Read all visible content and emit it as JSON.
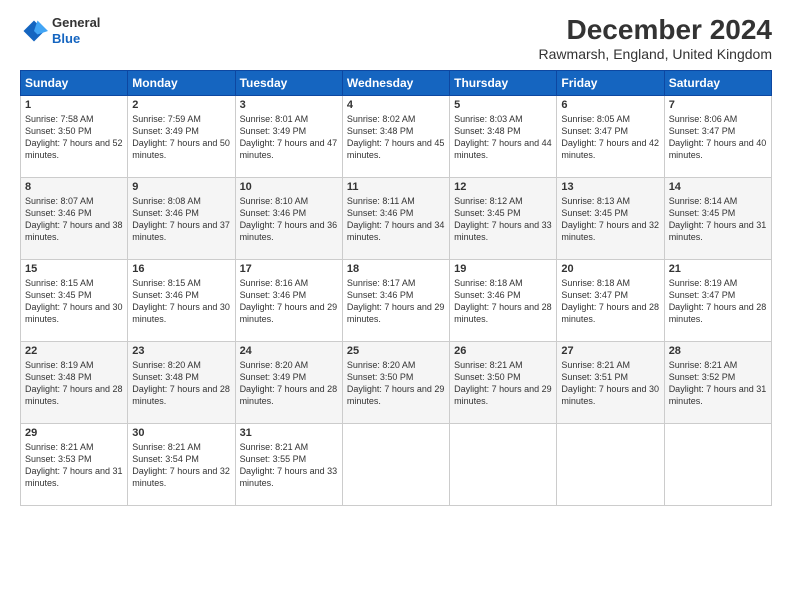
{
  "logo": {
    "line1": "General",
    "line2": "Blue"
  },
  "title": "December 2024",
  "subtitle": "Rawmarsh, England, United Kingdom",
  "header_days": [
    "Sunday",
    "Monday",
    "Tuesday",
    "Wednesday",
    "Thursday",
    "Friday",
    "Saturday"
  ],
  "weeks": [
    [
      {
        "day": "1",
        "sunrise": "7:58 AM",
        "sunset": "3:50 PM",
        "daylight": "7 hours and 52 minutes."
      },
      {
        "day": "2",
        "sunrise": "7:59 AM",
        "sunset": "3:49 PM",
        "daylight": "7 hours and 50 minutes."
      },
      {
        "day": "3",
        "sunrise": "8:01 AM",
        "sunset": "3:49 PM",
        "daylight": "7 hours and 47 minutes."
      },
      {
        "day": "4",
        "sunrise": "8:02 AM",
        "sunset": "3:48 PM",
        "daylight": "7 hours and 45 minutes."
      },
      {
        "day": "5",
        "sunrise": "8:03 AM",
        "sunset": "3:48 PM",
        "daylight": "7 hours and 44 minutes."
      },
      {
        "day": "6",
        "sunrise": "8:05 AM",
        "sunset": "3:47 PM",
        "daylight": "7 hours and 42 minutes."
      },
      {
        "day": "7",
        "sunrise": "8:06 AM",
        "sunset": "3:47 PM",
        "daylight": "7 hours and 40 minutes."
      }
    ],
    [
      {
        "day": "8",
        "sunrise": "8:07 AM",
        "sunset": "3:46 PM",
        "daylight": "7 hours and 38 minutes."
      },
      {
        "day": "9",
        "sunrise": "8:08 AM",
        "sunset": "3:46 PM",
        "daylight": "7 hours and 37 minutes."
      },
      {
        "day": "10",
        "sunrise": "8:10 AM",
        "sunset": "3:46 PM",
        "daylight": "7 hours and 36 minutes."
      },
      {
        "day": "11",
        "sunrise": "8:11 AM",
        "sunset": "3:46 PM",
        "daylight": "7 hours and 34 minutes."
      },
      {
        "day": "12",
        "sunrise": "8:12 AM",
        "sunset": "3:45 PM",
        "daylight": "7 hours and 33 minutes."
      },
      {
        "day": "13",
        "sunrise": "8:13 AM",
        "sunset": "3:45 PM",
        "daylight": "7 hours and 32 minutes."
      },
      {
        "day": "14",
        "sunrise": "8:14 AM",
        "sunset": "3:45 PM",
        "daylight": "7 hours and 31 minutes."
      }
    ],
    [
      {
        "day": "15",
        "sunrise": "8:15 AM",
        "sunset": "3:45 PM",
        "daylight": "7 hours and 30 minutes."
      },
      {
        "day": "16",
        "sunrise": "8:15 AM",
        "sunset": "3:46 PM",
        "daylight": "7 hours and 30 minutes."
      },
      {
        "day": "17",
        "sunrise": "8:16 AM",
        "sunset": "3:46 PM",
        "daylight": "7 hours and 29 minutes."
      },
      {
        "day": "18",
        "sunrise": "8:17 AM",
        "sunset": "3:46 PM",
        "daylight": "7 hours and 29 minutes."
      },
      {
        "day": "19",
        "sunrise": "8:18 AM",
        "sunset": "3:46 PM",
        "daylight": "7 hours and 28 minutes."
      },
      {
        "day": "20",
        "sunrise": "8:18 AM",
        "sunset": "3:47 PM",
        "daylight": "7 hours and 28 minutes."
      },
      {
        "day": "21",
        "sunrise": "8:19 AM",
        "sunset": "3:47 PM",
        "daylight": "7 hours and 28 minutes."
      }
    ],
    [
      {
        "day": "22",
        "sunrise": "8:19 AM",
        "sunset": "3:48 PM",
        "daylight": "7 hours and 28 minutes."
      },
      {
        "day": "23",
        "sunrise": "8:20 AM",
        "sunset": "3:48 PM",
        "daylight": "7 hours and 28 minutes."
      },
      {
        "day": "24",
        "sunrise": "8:20 AM",
        "sunset": "3:49 PM",
        "daylight": "7 hours and 28 minutes."
      },
      {
        "day": "25",
        "sunrise": "8:20 AM",
        "sunset": "3:50 PM",
        "daylight": "7 hours and 29 minutes."
      },
      {
        "day": "26",
        "sunrise": "8:21 AM",
        "sunset": "3:50 PM",
        "daylight": "7 hours and 29 minutes."
      },
      {
        "day": "27",
        "sunrise": "8:21 AM",
        "sunset": "3:51 PM",
        "daylight": "7 hours and 30 minutes."
      },
      {
        "day": "28",
        "sunrise": "8:21 AM",
        "sunset": "3:52 PM",
        "daylight": "7 hours and 31 minutes."
      }
    ],
    [
      {
        "day": "29",
        "sunrise": "8:21 AM",
        "sunset": "3:53 PM",
        "daylight": "7 hours and 31 minutes."
      },
      {
        "day": "30",
        "sunrise": "8:21 AM",
        "sunset": "3:54 PM",
        "daylight": "7 hours and 32 minutes."
      },
      {
        "day": "31",
        "sunrise": "8:21 AM",
        "sunset": "3:55 PM",
        "daylight": "7 hours and 33 minutes."
      },
      null,
      null,
      null,
      null
    ]
  ]
}
